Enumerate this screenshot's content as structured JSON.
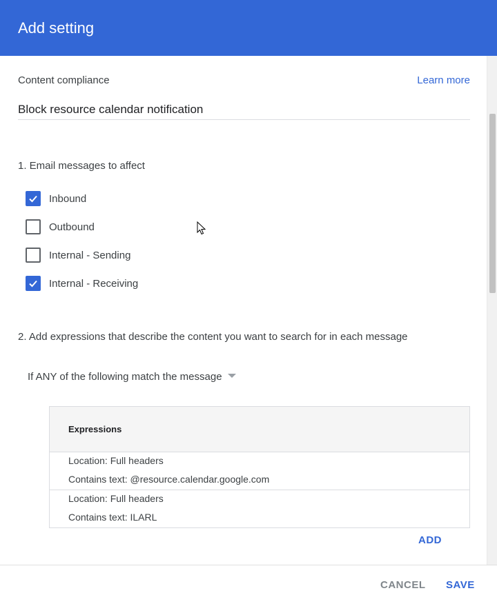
{
  "header": {
    "title": "Add setting"
  },
  "setting": {
    "section_label": "Content compliance",
    "learn_more_label": "Learn more",
    "name_value": "Block resource calendar notification"
  },
  "step1": {
    "title": "1. Email messages to affect",
    "options": [
      {
        "label": "Inbound",
        "checked": true
      },
      {
        "label": "Outbound",
        "checked": false
      },
      {
        "label": "Internal - Sending",
        "checked": false
      },
      {
        "label": "Internal - Receiving",
        "checked": true
      }
    ]
  },
  "step2": {
    "title": "2. Add expressions that describe the content you want to search for in each message",
    "match_mode": "If ANY of the following match the message",
    "table_header": "Expressions",
    "expressions": [
      {
        "location": "Location: Full headers",
        "contains": "Contains text: @resource.calendar.google.com"
      },
      {
        "location": "Location: Full headers",
        "contains": "Contains text: ILARL"
      }
    ],
    "add_label": "ADD"
  },
  "footer": {
    "cancel_label": "CANCEL",
    "save_label": "SAVE"
  },
  "colors": {
    "accent": "#3367d6",
    "header_bg": "#3367d6",
    "muted_button": "#80868b"
  }
}
